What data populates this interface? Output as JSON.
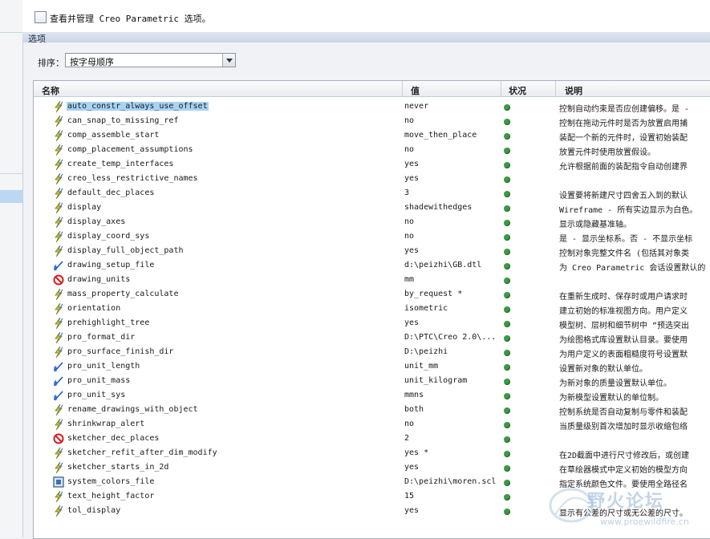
{
  "header": {
    "checkbox_label": "查看并管理 Creo Parametric 选项。"
  },
  "section": {
    "title": "选项"
  },
  "sort": {
    "label": "排序：",
    "selected": "按字母顺序"
  },
  "columns": {
    "name": "名称",
    "value": "值",
    "status": "状况",
    "description": "说明"
  },
  "rows": [
    {
      "icon": "lightning-icon",
      "name": "auto_constr_always_use_offset",
      "value": "never",
      "desc": "控制自动约束是否应创建偏移。是 -"
    },
    {
      "icon": "lightning-icon",
      "name": "can_snap_to_missing_ref",
      "value": "no",
      "desc": "控制在拖动元件时是否为放置启用捕"
    },
    {
      "icon": "lightning-icon",
      "name": "comp_assemble_start",
      "value": "move_then_place",
      "desc": "装配一个新的元件时，设置初始装配"
    },
    {
      "icon": "lightning-icon",
      "name": "comp_placement_assumptions",
      "value": "no",
      "desc": "放置元件时使用放置假设。"
    },
    {
      "icon": "lightning-icon",
      "name": "create_temp_interfaces",
      "value": "yes",
      "desc": "允许根据前面的装配指令自动创建界"
    },
    {
      "icon": "lightning-icon",
      "name": "creo_less_restrictive_names",
      "value": "yes",
      "desc": ""
    },
    {
      "icon": "lightning-icon",
      "name": "default_dec_places",
      "value": "3",
      "desc": "设置要将新建尺寸四舍五入到的默认"
    },
    {
      "icon": "lightning-icon",
      "name": "display",
      "value": "shadewithedges",
      "desc": "Wireframe - 所有实边显示为白色。"
    },
    {
      "icon": "lightning-icon",
      "name": "display_axes",
      "value": "no",
      "desc": "显示或隐藏基准轴。"
    },
    {
      "icon": "lightning-icon",
      "name": "display_coord_sys",
      "value": "no",
      "desc": "是 - 显示坐标系。否 - 不显示坐标"
    },
    {
      "icon": "lightning-icon",
      "name": "display_full_object_path",
      "value": "yes",
      "desc": "控制对象完整文件名 (包括其对象类"
    },
    {
      "icon": "spark-icon",
      "name": "drawing_setup_file",
      "value": "d:\\peizhi\\GB.dtl",
      "desc": "为 Creo Parametric 会话设置默认的"
    },
    {
      "icon": "no-entry-icon",
      "name": "drawing_units",
      "value": "mm",
      "desc": ""
    },
    {
      "icon": "lightning-icon",
      "name": "mass_property_calculate",
      "value": "by_request *",
      "desc": "在重新生成时、保存时或用户请求时"
    },
    {
      "icon": "lightning-icon",
      "name": "orientation",
      "value": "isometric",
      "desc": "建立初始的标准视图方向。用户定义"
    },
    {
      "icon": "lightning-icon",
      "name": "prehighlight_tree",
      "value": "yes",
      "desc": "模型树、层树和细节树中 “预选突出"
    },
    {
      "icon": "lightning-icon",
      "name": "pro_format_dir",
      "value": "D:\\PTC\\Creo 2.0\\...",
      "desc": "为绘图格式库设置默认目录。要使用"
    },
    {
      "icon": "lightning-icon",
      "name": "pro_surface_finish_dir",
      "value": "D:\\peizhi",
      "desc": "为用户定义的表面粗糙度符号设置默"
    },
    {
      "icon": "spark-icon",
      "name": "pro_unit_length",
      "value": "unit_mm",
      "desc": "设置新对象的默认单位。"
    },
    {
      "icon": "spark-icon",
      "name": "pro_unit_mass",
      "value": "unit_kilogram",
      "desc": "为新对象的质量设置默认单位。"
    },
    {
      "icon": "spark-icon",
      "name": "pro_unit_sys",
      "value": "mmns",
      "desc": "为新模型设置默认的单位制。"
    },
    {
      "icon": "lightning-icon",
      "name": "rename_drawings_with_object",
      "value": "both",
      "desc": "控制系统是否自动复制与零件和装配"
    },
    {
      "icon": "lightning-icon",
      "name": "shrinkwrap_alert",
      "value": "no",
      "desc": "当质量级别首次增加时显示收缩包络"
    },
    {
      "icon": "no-entry-icon",
      "name": "sketcher_dec_places",
      "value": "2",
      "desc": ""
    },
    {
      "icon": "lightning-icon",
      "name": "sketcher_refit_after_dim_modify",
      "value": "yes *",
      "desc": "在2D截面中进行尺寸修改后，或创建"
    },
    {
      "icon": "lightning-icon",
      "name": "sketcher_starts_in_2d",
      "value": "yes",
      "desc": "在草绘器模式中定义初始的模型方向"
    },
    {
      "icon": "monitor-icon",
      "name": "system_colors_file",
      "value": "D:\\peizhi\\moren.scl",
      "desc": "指定系统颜色文件。要使用全路径名"
    },
    {
      "icon": "lightning-icon",
      "name": "text_height_factor",
      "value": "15",
      "desc": ""
    },
    {
      "icon": "lightning-icon",
      "name": "tol_display",
      "value": "yes",
      "desc": "显示有公差的尺寸或无公差的尺寸。"
    }
  ],
  "selected_row_index": 0,
  "watermark": {
    "text": "野火论坛",
    "url": "www.proewildfire.cn"
  }
}
